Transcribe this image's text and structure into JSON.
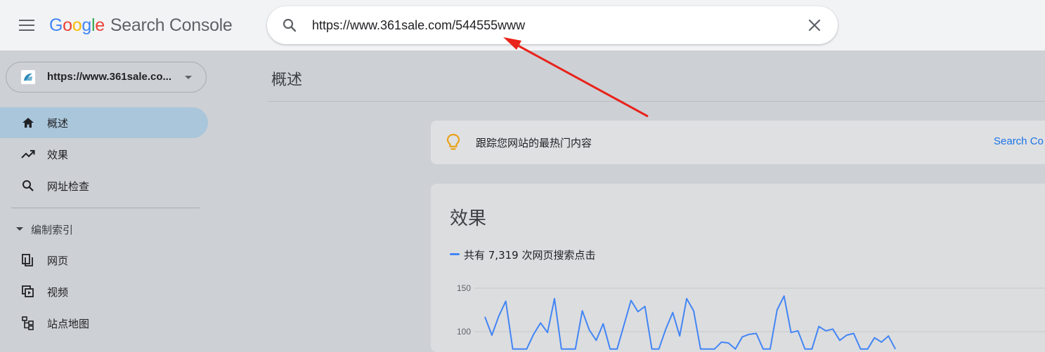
{
  "header": {
    "logo_letters": [
      "G",
      "o",
      "o",
      "g",
      "l",
      "e"
    ],
    "product": "Search Console",
    "search_value": "https://www.361sale.com/544555www"
  },
  "sidebar": {
    "property_label": "https://www.361sale.co...",
    "items": [
      {
        "label": "概述",
        "icon": "home-icon",
        "active": true
      },
      {
        "label": "效果",
        "icon": "trending-up-icon",
        "active": false
      },
      {
        "label": "网址检查",
        "icon": "search-icon",
        "active": false
      }
    ],
    "section": {
      "label": "编制索引",
      "expanded": true
    },
    "section_items": [
      {
        "label": "网页",
        "icon": "pages-icon"
      },
      {
        "label": "视频",
        "icon": "video-pages-icon"
      },
      {
        "label": "站点地图",
        "icon": "sitemap-icon"
      }
    ]
  },
  "main": {
    "page_title": "概述",
    "tip": {
      "text": "跟踪您网站的最热门内容",
      "link": "Search Co"
    },
    "performance": {
      "title": "效果",
      "legend": "共有 7,319 次网页搜索点击",
      "series_color": "#4285f4"
    }
  },
  "chart_data": {
    "type": "line",
    "title": "效果",
    "series": [
      {
        "name": "共有 7,319 次网页搜索点击",
        "values": [
          117,
          96,
          118,
          135,
          80,
          80,
          80,
          97,
          110,
          99,
          138,
          80,
          80,
          80,
          124,
          102,
          90,
          109,
          80,
          80,
          108,
          136,
          123,
          129,
          80,
          80,
          103,
          122,
          95,
          138,
          124,
          80,
          80,
          80,
          88,
          87,
          80,
          94,
          97,
          98,
          80,
          80,
          125,
          141,
          99,
          101,
          80,
          80,
          106,
          101,
          103,
          90,
          96,
          98,
          80,
          80,
          93,
          88,
          95,
          80
        ]
      }
    ],
    "y_ticks": [
      "150",
      "100"
    ],
    "ylim": [
      100,
      150
    ],
    "grid": true
  },
  "colors": {
    "accent": "#1a73e8",
    "active_nav": "#a9c6db",
    "annotation_arrow": "#e8231a"
  }
}
